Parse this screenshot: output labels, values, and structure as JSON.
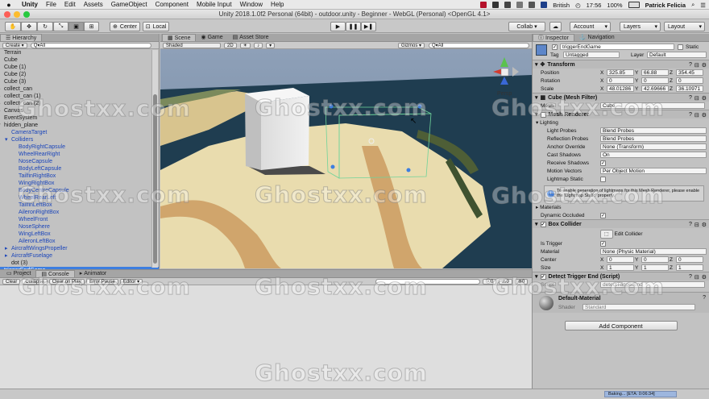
{
  "menubar": {
    "app": "Unity",
    "items": [
      "File",
      "Edit",
      "Assets",
      "GameObject",
      "Component",
      "Mobile Input",
      "Window",
      "Help"
    ],
    "locale": "British",
    "time": "17:56",
    "battery": "100%",
    "user": "Patrick Felicia"
  },
  "window": {
    "title": "Unity 2018.1.0f2 Personal (64bit) - outdoor.unity - Beginner - WebGL (Personal) <OpenGL 4.1>"
  },
  "toolbar": {
    "center": "Center",
    "local": "Local",
    "collab": "Collab ▾",
    "account": "Account",
    "layers": "Layers",
    "layout": "Layout"
  },
  "hierarchy": {
    "tab": "Hierarchy",
    "create": "Create ▾",
    "search": "Q▾All",
    "items": [
      {
        "t": "Terrain",
        "d": 1,
        "c": "n"
      },
      {
        "t": "Cube",
        "d": 1,
        "c": "n"
      },
      {
        "t": "Cube (1)",
        "d": 1,
        "c": "n"
      },
      {
        "t": "Cube (2)",
        "d": 1,
        "c": "n"
      },
      {
        "t": "Cube (3)",
        "d": 1,
        "c": "n"
      },
      {
        "t": "collect_can",
        "d": 1,
        "c": "n",
        "a": "▸"
      },
      {
        "t": "collect_can (1)",
        "d": 1,
        "c": "n",
        "a": "▸"
      },
      {
        "t": "collect_can (2)",
        "d": 1,
        "c": "n",
        "a": "▸"
      },
      {
        "t": "Canvas",
        "d": 1,
        "c": "n",
        "a": "▸"
      },
      {
        "t": "EventSystem",
        "d": 1,
        "c": "n"
      },
      {
        "t": "hidden_plane",
        "d": 1,
        "c": "n",
        "a": "▾"
      },
      {
        "t": "CameraTarget",
        "d": 2,
        "c": "b"
      },
      {
        "t": "Colliders",
        "d": 2,
        "c": "b",
        "a": "▾"
      },
      {
        "t": "BodyRightCapsule",
        "d": 3,
        "c": "b"
      },
      {
        "t": "WheelRearRight",
        "d": 3,
        "c": "b"
      },
      {
        "t": "NoseCapsule",
        "d": 3,
        "c": "b"
      },
      {
        "t": "BodyLeftCapsule",
        "d": 3,
        "c": "b"
      },
      {
        "t": "TailfinRightBox",
        "d": 3,
        "c": "b"
      },
      {
        "t": "WingRightBox",
        "d": 3,
        "c": "b"
      },
      {
        "t": "BodyCentreCapsule",
        "d": 3,
        "c": "b"
      },
      {
        "t": "WheelRearLeft",
        "d": 3,
        "c": "b"
      },
      {
        "t": "TailfinLeftBox",
        "d": 3,
        "c": "b"
      },
      {
        "t": "AileronRightBox",
        "d": 3,
        "c": "b"
      },
      {
        "t": "WheelFront",
        "d": 3,
        "c": "b"
      },
      {
        "t": "NoseSphere",
        "d": 3,
        "c": "b"
      },
      {
        "t": "WingLeftBox",
        "d": 3,
        "c": "b"
      },
      {
        "t": "AileronLeftBox",
        "d": 3,
        "c": "b"
      },
      {
        "t": "AircraftWingsPropeller",
        "d": 2,
        "c": "b",
        "a": "▸"
      },
      {
        "t": "AircraftFuselage",
        "d": 2,
        "c": "b",
        "a": "▸"
      },
      {
        "t": "dot (3)",
        "d": 2,
        "c": "n"
      },
      {
        "t": "triggerEndGame",
        "d": 1,
        "c": "s"
      }
    ]
  },
  "scene": {
    "tabs": [
      "Scene",
      "Game",
      "Asset Store"
    ],
    "shading": "Shaded",
    "mode2d": "2D",
    "gizmos": "Gizmos ▾",
    "search": "Q▾All",
    "persp": "Persp"
  },
  "bottom": {
    "tabs": [
      "Project",
      "Console",
      "Animator"
    ],
    "buttons": [
      "Clear",
      "Collapse",
      "Clear on Play",
      "Error Pause",
      "Editor ▾"
    ],
    "counts": [
      "0",
      "0",
      "0"
    ]
  },
  "status": {
    "baking": "Baking...",
    "eta": "[ETA: 0:06:34]"
  },
  "inspector": {
    "tabs": [
      "Inspector",
      "Navigation"
    ],
    "name": "triggerEndGame",
    "static": "Static",
    "tag": "Untagged",
    "layer": "Default",
    "transform": {
      "title": "Transform",
      "rows": [
        {
          "label": "Position",
          "x": "325.85",
          "y": "66.88",
          "z": "354.45"
        },
        {
          "label": "Rotation",
          "x": "0",
          "y": "0",
          "z": "0"
        },
        {
          "label": "Scale",
          "x": "48.01286",
          "y": "42.69666",
          "z": "36.10971"
        }
      ]
    },
    "meshfilter": {
      "title": "Cube (Mesh Filter)",
      "mesh_label": "Mesh",
      "mesh": "Cube"
    },
    "renderer": {
      "title": "Mesh Renderer",
      "lighting": "Lighting",
      "rows": [
        {
          "label": "Light Probes",
          "value": "Blend Probes"
        },
        {
          "label": "Reflection Probes",
          "value": "Blend Probes"
        },
        {
          "label": "Anchor Override",
          "value": "None (Transform)"
        },
        {
          "label": "Cast Shadows",
          "value": "On"
        },
        {
          "label": "Receive Shadows",
          "value": "✓"
        },
        {
          "label": "Motion Vectors",
          "value": "Per Object Motion"
        },
        {
          "label": "Lightmap Static",
          "value": ""
        }
      ],
      "info": "To enable generation of lightmaps for this Mesh Renderer, please enable the 'Lightmap Static' property.",
      "materials": "Materials",
      "occluded": "Dynamic Occluded"
    },
    "boxcollider": {
      "title": "Box Collider",
      "edit": "Edit Collider",
      "rows": [
        {
          "label": "Is Trigger",
          "value": "✓"
        },
        {
          "label": "Material",
          "value": "None (Physic Material)"
        }
      ],
      "center": {
        "label": "Center",
        "x": "0",
        "y": "0",
        "z": "0"
      },
      "size": {
        "label": "Size",
        "x": "1",
        "y": "1",
        "z": "1"
      }
    },
    "script": {
      "title": "Detect Trigger End (Script)",
      "label": "Script",
      "value": "detectTriggerEnd"
    },
    "material": {
      "name": "Default-Material",
      "shader_label": "Shader",
      "shader": "Standard"
    },
    "add": "Add Component"
  },
  "watermark": "Ghostxx.com"
}
